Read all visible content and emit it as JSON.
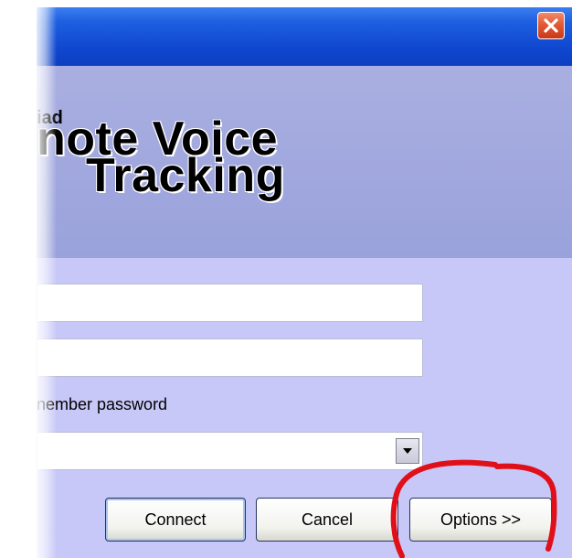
{
  "window": {
    "close_icon": "close-x-icon"
  },
  "logo": {
    "line_small": "iad",
    "line1": "note Voice",
    "line2": "Tracking"
  },
  "form": {
    "username_value": "",
    "password_value": "",
    "remember_label": "nember password",
    "server_value": ""
  },
  "buttons": {
    "connect": "Connect",
    "cancel": "Cancel",
    "options": "Options >>"
  },
  "colors": {
    "title_bar": "#1047d0",
    "banner": "#a0a8de",
    "form_bg": "#c8c8f8",
    "highlight_circle": "#e0101a"
  }
}
